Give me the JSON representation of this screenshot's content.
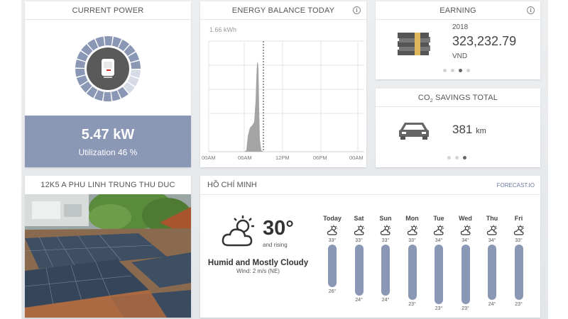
{
  "colors": {
    "accent": "#8a97b5",
    "bar": "#8a97b5",
    "dark": "#555555",
    "chart": "#9a9a9a"
  },
  "power": {
    "title": "CURRENT POWER",
    "icon": "inverter-icon",
    "value": "5.47 kW",
    "utilization": "Utilization 46 %",
    "ring_segments": 22,
    "ring_active": 19
  },
  "energy": {
    "title": "ENERGY BALANCE TODAY",
    "ymax_label": "1.66 kWh",
    "x_ticks": [
      "00AM",
      "06AM",
      "12PM",
      "06PM",
      "00AM"
    ],
    "info": "i"
  },
  "earning": {
    "title": "EARNING",
    "year": "2018",
    "amount": "323,232.79",
    "currency": "VND",
    "info": "i",
    "icon": "money-stack-icon",
    "pages": 4,
    "active_page": 2
  },
  "co2": {
    "title_pre": "CO",
    "title_sub": "2",
    "title_post": " SAVINGS TOTAL",
    "value": "381",
    "unit": "km",
    "icon": "car-icon",
    "pages": 3,
    "active_page": 2
  },
  "site": {
    "title": "12K5 A PHU LINH TRUNG THU DUC",
    "image": "rooftop-solar-panels-photo"
  },
  "weather": {
    "title": "HỒ CHÍ MINH",
    "link": "FORECAST.IO",
    "temp": "30°",
    "trend": "and rising",
    "summary": "Humid and Mostly Cloudy",
    "wind": "Wind: 2 m/s (NE)",
    "icon": "partly-cloudy-day-icon",
    "days": [
      {
        "name": "Today",
        "hi": "33°",
        "lo": "26°"
      },
      {
        "name": "Sat",
        "hi": "33°",
        "lo": "24°"
      },
      {
        "name": "Sun",
        "hi": "33°",
        "lo": "24°"
      },
      {
        "name": "Mon",
        "hi": "33°",
        "lo": "23°"
      },
      {
        "name": "Tue",
        "hi": "34°",
        "lo": "23°"
      },
      {
        "name": "Wed",
        "hi": "34°",
        "lo": "23°"
      },
      {
        "name": "Thu",
        "hi": "34°",
        "lo": "24°"
      },
      {
        "name": "Fri",
        "hi": "33°",
        "lo": "23°"
      }
    ]
  }
}
